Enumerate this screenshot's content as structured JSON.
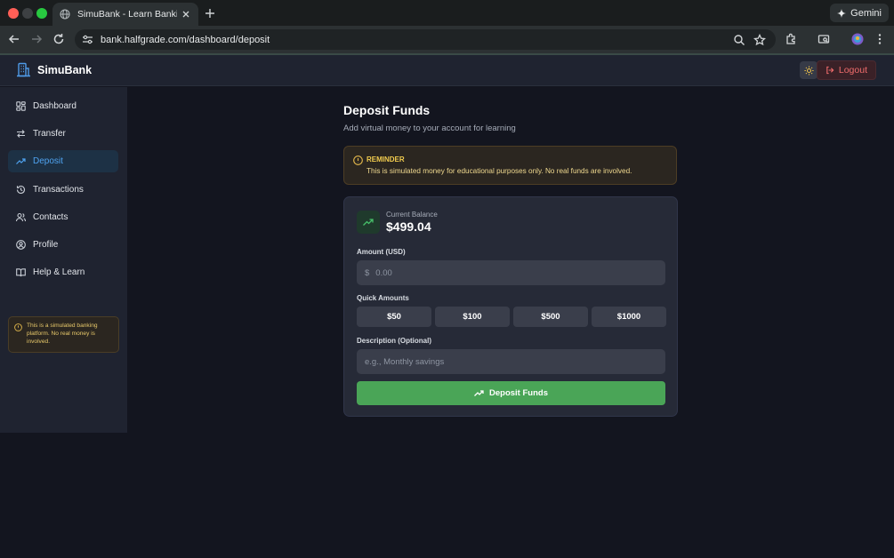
{
  "browser": {
    "tab_title": "SimuBank - Learn Banking Sa",
    "url": "bank.halfgrade.com/dashboard/deposit",
    "gemini_label": "Gemini",
    "traffic_colors": [
      "#ff5f57",
      "#3d4043",
      "#28c840"
    ]
  },
  "header": {
    "brand": "SimuBank",
    "logout_label": "Logout"
  },
  "sidebar": {
    "items": [
      {
        "label": "Dashboard",
        "icon": "grid-icon",
        "active": false
      },
      {
        "label": "Transfer",
        "icon": "arrows-icon",
        "active": false
      },
      {
        "label": "Deposit",
        "icon": "trending-up-icon",
        "active": true
      },
      {
        "label": "Transactions",
        "icon": "history-icon",
        "active": false
      },
      {
        "label": "Contacts",
        "icon": "users-icon",
        "active": false
      },
      {
        "label": "Profile",
        "icon": "user-circle-icon",
        "active": false
      },
      {
        "label": "Help & Learn",
        "icon": "book-icon",
        "active": false
      }
    ],
    "note": "This is a simulated banking platform. No real money is involved."
  },
  "main": {
    "title": "Deposit Funds",
    "subtitle": "Add virtual money to your account for learning",
    "reminder_heading": "REMINDER",
    "reminder_body": "This is simulated money for educational purposes only. No real funds are involved.",
    "balance_label": "Current Balance",
    "balance_value": "$499.04",
    "amount_label": "Amount (USD)",
    "currency_symbol": "$",
    "amount_placeholder": "0.00",
    "quick_label": "Quick Amounts",
    "quick_amounts": [
      "$50",
      "$100",
      "$500",
      "$1000"
    ],
    "description_label": "Description (Optional)",
    "description_placeholder": "e.g., Monthly savings",
    "submit_label": "Deposit Funds"
  },
  "colors": {
    "accent_blue": "#4fa3f0",
    "success_green": "#4aa557",
    "warning_amber": "#e3b84c",
    "danger_red": "#f06c6c"
  }
}
